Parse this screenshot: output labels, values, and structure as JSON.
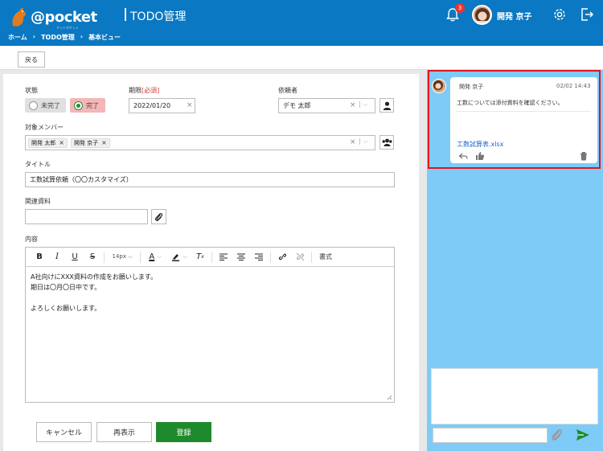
{
  "header": {
    "logo_text": "@pocket",
    "logo_sub": "アットポケット",
    "app_title": "TODO管理",
    "notification_count": "3",
    "user_name": "開発 京子",
    "breadcrumb": [
      "ホーム",
      "TODO管理",
      "基本ビュー"
    ]
  },
  "toolbar": {
    "back_label": "戻る"
  },
  "form": {
    "status": {
      "label": "状態",
      "options": [
        {
          "label": "未完了",
          "selected": false
        },
        {
          "label": "完了",
          "selected": true
        }
      ]
    },
    "due": {
      "label": "期限",
      "required_mark": "[必須]",
      "value": "2022/01/20"
    },
    "requester": {
      "label": "依頼者",
      "value": "デモ 太郎"
    },
    "members": {
      "label": "対象メンバー",
      "tags": [
        "開発 太郎",
        "開発 京子"
      ]
    },
    "title": {
      "label": "タイトル",
      "value": "工数試算依頼（〇〇カスタマイズ）"
    },
    "related": {
      "label": "関連資料",
      "value": ""
    },
    "content": {
      "label": "内容",
      "font_size": "14px",
      "format_label": "書式",
      "lines": [
        "A社向けにXXX資料の作成をお願いします。",
        "期日は〇月〇日中です。",
        "",
        "よろしくお願いします。"
      ]
    },
    "buttons": {
      "cancel": "キャンセル",
      "redisplay": "再表示",
      "register": "登録"
    }
  },
  "comments": [
    {
      "author": "開発 京子",
      "time": "02/02 14:43",
      "text": "工数については添付資料を確認ください。",
      "attachment": "工数試算表.xlsx"
    }
  ],
  "colors": {
    "header_bg": "#0a78c2",
    "chat_bg": "#7ecbf7",
    "primary_button": "#1e8a2c",
    "highlight_border": "#e0141f",
    "badge": "#e33333"
  }
}
